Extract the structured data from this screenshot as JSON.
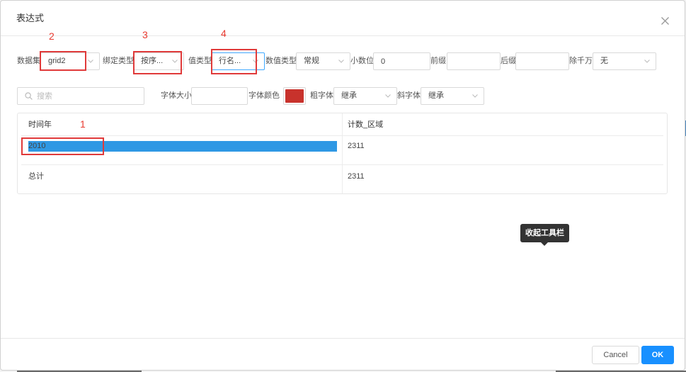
{
  "dialog": {
    "title": "表达式",
    "close_icon": "close-icon"
  },
  "toolbar": {
    "dataset": {
      "label": "数据集",
      "value": "grid2"
    },
    "bind_type": {
      "label": "绑定类型",
      "value": "按序..."
    },
    "value_type": {
      "label": "值类型",
      "value": "行名..."
    },
    "number_type": {
      "label": "数值类型",
      "value": "常规"
    },
    "decimals": {
      "label": "小数位",
      "value": "0"
    },
    "prefix": {
      "label": "前缀",
      "value": ""
    },
    "suffix": {
      "label": "后缀",
      "value": ""
    },
    "divide": {
      "label": "除千万",
      "value": "无"
    },
    "search": {
      "placeholder": "搜索",
      "icon": "search-icon"
    },
    "font_size": {
      "label": "字体大小",
      "value": ""
    },
    "font_color": {
      "label": "字体颜色",
      "color": "#c8322c"
    },
    "bold": {
      "label": "粗字体",
      "value": "继承"
    },
    "italic": {
      "label": "斜字体",
      "value": "继承"
    },
    "dropdown_icon": "chevron-down-icon"
  },
  "table": {
    "columns": [
      "时间年",
      "计数_区域"
    ],
    "rows": [
      [
        "2010",
        "2311"
      ],
      [
        "总计",
        "2311"
      ]
    ],
    "selected_row": 0
  },
  "annotations": [
    "1",
    "2",
    "3",
    "4"
  ],
  "tooltip": {
    "text": "收起工具栏"
  },
  "footer": {
    "cancel_label": "Cancel",
    "ok_label": "OK"
  },
  "colors": {
    "accent": "#1890ff",
    "focus_border": "#40a9ff",
    "selection": "#2f98e4",
    "annotation": "#e03a3a",
    "tooltip_bg": "#333333"
  }
}
